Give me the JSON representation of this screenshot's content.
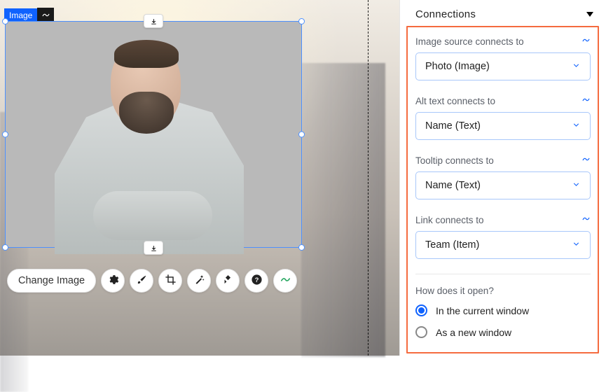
{
  "element": {
    "tag": "Image"
  },
  "toolbar": {
    "change_image": "Change Image"
  },
  "panel": {
    "title": "Connections",
    "fields": [
      {
        "label": "Image source connects to",
        "value": "Photo (Image)"
      },
      {
        "label": "Alt text connects to",
        "value": "Name (Text)"
      },
      {
        "label": "Tooltip connects to",
        "value": "Name (Text)"
      },
      {
        "label": "Link connects to",
        "value": "Team (Item)"
      }
    ],
    "open_question": "How does it open?",
    "open_options": {
      "current": "In the current window",
      "new": "As a new window"
    },
    "open_selected": "current"
  }
}
